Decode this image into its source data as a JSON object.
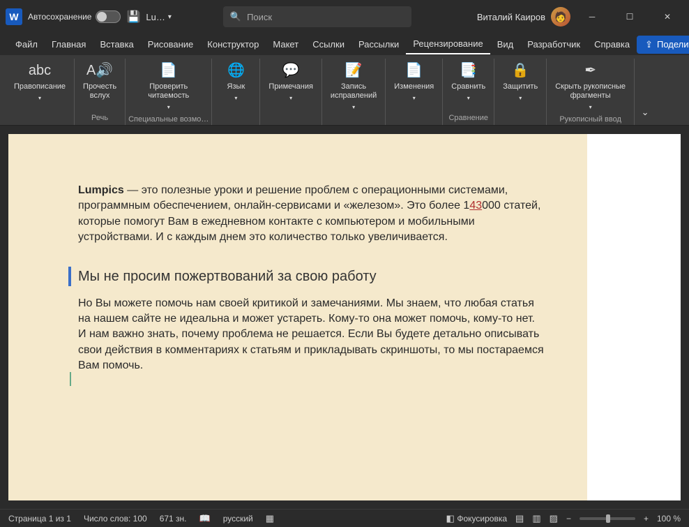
{
  "titlebar": {
    "autosave_label": "Автосохранение",
    "doc_name": "Lu…",
    "search_placeholder": "Поиск",
    "user_name": "Виталий Каиров"
  },
  "tabs": [
    "Файл",
    "Главная",
    "Вставка",
    "Рисование",
    "Конструктор",
    "Макет",
    "Ссылки",
    "Рассылки",
    "Рецензирование",
    "Вид",
    "Разработчик",
    "Справка"
  ],
  "active_tab": 8,
  "share_label": "Поделиться",
  "ribbon": {
    "groups": [
      {
        "title": "",
        "items": [
          {
            "label": "Правописание",
            "chev": true,
            "icon": "abc"
          }
        ]
      },
      {
        "title": "Речь",
        "items": [
          {
            "label": "Прочесть\nвслух",
            "chev": false,
            "icon": "A🔊"
          }
        ]
      },
      {
        "title": "Специальные возмо…",
        "items": [
          {
            "label": "Проверить\nчитаемость",
            "chev": true,
            "icon": "📄"
          }
        ]
      },
      {
        "title": "",
        "items": [
          {
            "label": "Язык",
            "chev": true,
            "icon": "🌐"
          }
        ]
      },
      {
        "title": "",
        "items": [
          {
            "label": "Примечания",
            "chev": true,
            "icon": "💬"
          }
        ]
      },
      {
        "title": "",
        "items": [
          {
            "label": "Запись\nисправлений",
            "chev": true,
            "icon": "📝"
          }
        ]
      },
      {
        "title": "",
        "items": [
          {
            "label": "Изменения",
            "chev": true,
            "icon": "📄"
          }
        ]
      },
      {
        "title": "Сравнение",
        "items": [
          {
            "label": "Сравнить",
            "chev": true,
            "icon": "📑"
          }
        ]
      },
      {
        "title": "",
        "items": [
          {
            "label": "Защитить",
            "chev": true,
            "icon": "🔒"
          }
        ]
      },
      {
        "title": "Рукописный ввод",
        "items": [
          {
            "label": "Скрыть рукописные\nфрагменты",
            "chev": true,
            "icon": "✒"
          }
        ]
      }
    ]
  },
  "document": {
    "para1_bold": "Lumpics",
    "para1_a": " — это полезные уроки и решение проблем с операционными системами, программным обеспечением, онлайн-сервисами и «железом». Это более 1",
    "para1_tracked": "43",
    "para1_b": "000 статей, которые помогут Вам в ежедневном контакте с компьютером и мобильными устройствами. И с каждым днем это количество только увеличивается.",
    "heading": "Мы не просим пожертвований за свою работу",
    "para2": "Но Вы можете помочь нам своей критикой и замечаниями. Мы знаем, что любая статья на нашем сайте не идеальна и может устареть. Кому-то она может помочь, кому-то нет. И нам важно знать, почему проблема не решается. Если Вы будете детально описывать свои действия в комментариях к статьям и прикладывать скриншоты, то мы постараемся Вам помочь."
  },
  "status": {
    "page": "Страница 1 из 1",
    "words": "Число слов: 100",
    "chars": "671 зн.",
    "lang": "русский",
    "focus": "Фокусировка",
    "zoom": "100 %"
  }
}
